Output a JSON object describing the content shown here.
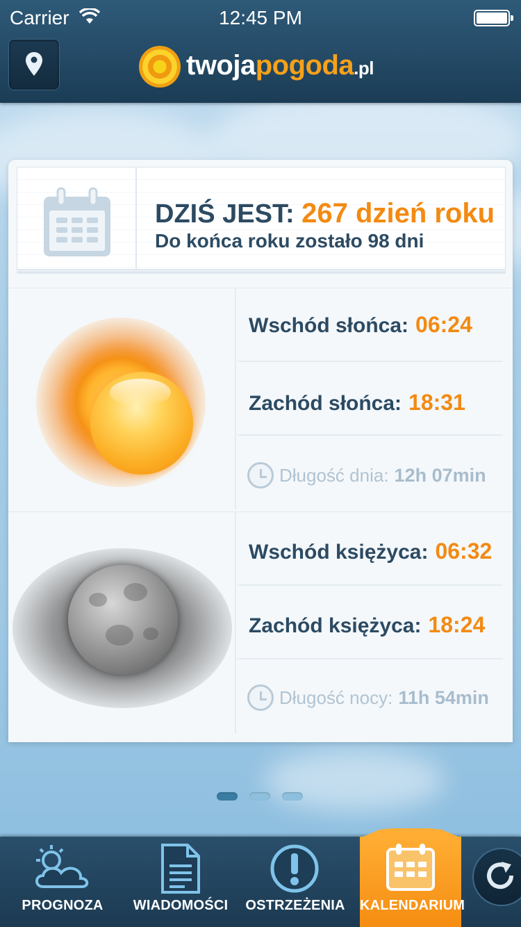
{
  "status_bar": {
    "carrier": "Carrier",
    "time": "12:45 PM"
  },
  "header": {
    "logo_part1": "twoja",
    "logo_part2": "pogoda",
    "logo_part3": ".pl",
    "location_icon": "location-pin-icon"
  },
  "calendar": {
    "today_prefix": "DZIŚ JEST:",
    "today_highlight": "267 dzień roku",
    "days_left": "Do końca roku zostało 98 dni"
  },
  "sun": {
    "rise_label": "Wschód słońca:",
    "rise_value": "06:24",
    "set_label": "Zachód słońca:",
    "set_value": "18:31",
    "length_label": "Długość dnia:",
    "length_value": "12h 07min"
  },
  "moon": {
    "rise_label": "Wschód księżyca:",
    "rise_value": "06:32",
    "set_label": "Zachód księżyca:",
    "set_value": "18:24",
    "length_label": "Długość nocy:",
    "length_value": "11h 54min"
  },
  "pager": {
    "pages": 3,
    "active": 1
  },
  "tabs": [
    {
      "label": "PROGNOZA",
      "icon": "cloud-sun-icon"
    },
    {
      "label": "WIADOMOŚCI",
      "icon": "document-icon"
    },
    {
      "label": "OSTRZEŻENIA",
      "icon": "warning-icon"
    },
    {
      "label": "KALENDARIUM",
      "icon": "calendar-icon",
      "active": true
    }
  ],
  "colors": {
    "accent": "#f38a12",
    "text_dark": "#2c4a62",
    "bar": "#1c3a52"
  }
}
